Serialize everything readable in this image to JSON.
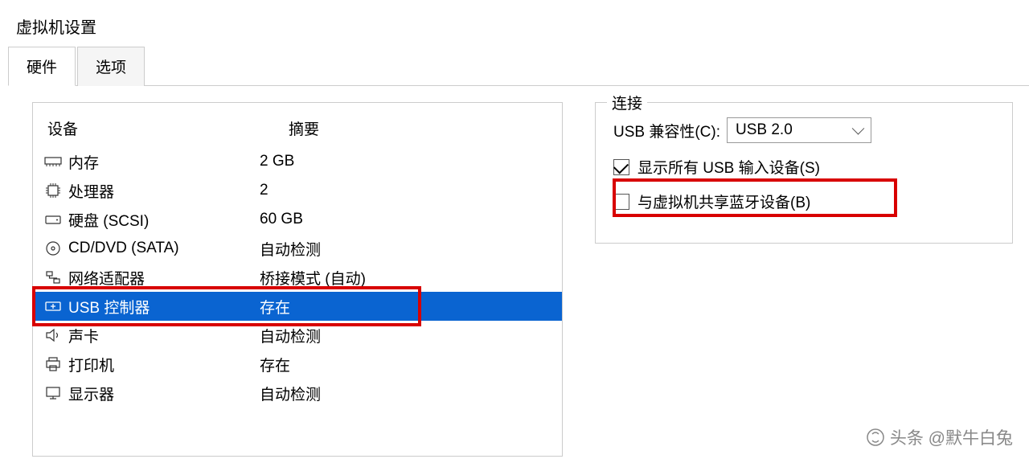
{
  "window": {
    "title": "虚拟机设置"
  },
  "tabs": {
    "hardware": "硬件",
    "options": "选项"
  },
  "list": {
    "header_device": "设备",
    "header_summary": "摘要",
    "rows": [
      {
        "name": "内存",
        "summary": "2 GB",
        "icon": "memory"
      },
      {
        "name": "处理器",
        "summary": "2",
        "icon": "cpu"
      },
      {
        "name": "硬盘 (SCSI)",
        "summary": "60 GB",
        "icon": "disk"
      },
      {
        "name": "CD/DVD (SATA)",
        "summary": "自动检测",
        "icon": "cd"
      },
      {
        "name": "网络适配器",
        "summary": "桥接模式 (自动)",
        "icon": "network"
      },
      {
        "name": "USB 控制器",
        "summary": "存在",
        "icon": "usb",
        "selected": true
      },
      {
        "name": "声卡",
        "summary": "自动检测",
        "icon": "sound"
      },
      {
        "name": "打印机",
        "summary": "存在",
        "icon": "printer"
      },
      {
        "name": "显示器",
        "summary": "自动检测",
        "icon": "display"
      }
    ]
  },
  "connection": {
    "legend": "连接",
    "compat_label": "USB 兼容性(C):",
    "compat_value": "USB 2.0",
    "show_all_usb_label": "显示所有 USB 输入设备(S)",
    "show_all_usb_checked": true,
    "share_bluetooth_label": "与虚拟机共享蓝牙设备(B)",
    "share_bluetooth_checked": false
  },
  "watermark": {
    "text": "头条 @默牛白兔"
  }
}
